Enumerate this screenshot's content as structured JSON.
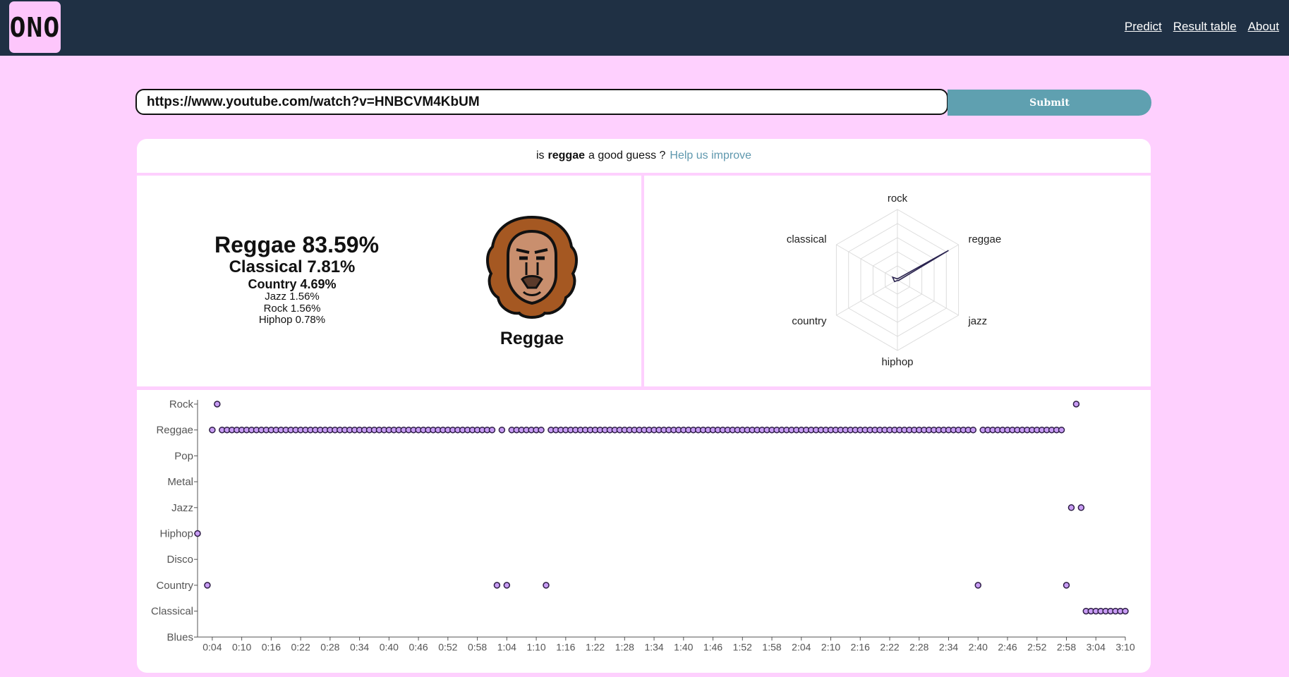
{
  "app": {
    "logo_text": "ONO"
  },
  "nav": {
    "predict": "Predict",
    "result_table": "Result table",
    "about": "About"
  },
  "search": {
    "value": "https://www.youtube.com/watch?v=HNBCVM4KbUM",
    "submit_label": "Submit"
  },
  "feedback": {
    "prefix": "is",
    "genre": "reggae",
    "suffix": "a good guess ?",
    "link": "Help us improve"
  },
  "probabilities": [
    "Reggae 83.59%",
    "Classical 7.81%",
    "Country 4.69%",
    "Jazz 1.56%",
    "Rock 1.56%",
    "Hiphop 0.78%"
  ],
  "prediction": {
    "label": "Reggae",
    "icon": "lion-icon"
  },
  "radar": {
    "axes": [
      "rock",
      "reggae",
      "jazz",
      "hiphop",
      "country",
      "classical"
    ],
    "values": [
      0.0156,
      0.8359,
      0.0156,
      0.0078,
      0.0469,
      0.0781
    ]
  },
  "chart_data": {
    "type": "scatter",
    "categories_y": [
      "Rock",
      "Reggae",
      "Pop",
      "Metal",
      "Jazz",
      "Hiphop",
      "Disco",
      "Country",
      "Classical",
      "Blues"
    ],
    "x_ticks": [
      "0:04",
      "0:10",
      "0:16",
      "0:22",
      "0:28",
      "0:34",
      "0:40",
      "0:46",
      "0:52",
      "0:58",
      "1:04",
      "1:10",
      "1:16",
      "1:22",
      "1:28",
      "1:34",
      "1:40",
      "1:46",
      "1:52",
      "1:58",
      "2:04",
      "2:10",
      "2:16",
      "2:22",
      "2:28",
      "2:34",
      "2:40",
      "2:46",
      "2:52",
      "2:58",
      "3:04",
      "3:10"
    ],
    "x_unit": "seconds",
    "xlim": [
      1,
      190
    ],
    "runs": [
      {
        "genre": "Hiphop",
        "start": 1,
        "end": 1
      },
      {
        "genre": "Country",
        "start": 3,
        "end": 3
      },
      {
        "genre": "Reggae",
        "start": 4,
        "end": 4
      },
      {
        "genre": "Rock",
        "start": 5,
        "end": 5
      },
      {
        "genre": "Reggae",
        "start": 6,
        "end": 61
      },
      {
        "genre": "Country",
        "start": 62,
        "end": 62
      },
      {
        "genre": "Reggae",
        "start": 63,
        "end": 63
      },
      {
        "genre": "Country",
        "start": 64,
        "end": 64
      },
      {
        "genre": "Reggae",
        "start": 65,
        "end": 71
      },
      {
        "genre": "Country",
        "start": 72,
        "end": 72
      },
      {
        "genre": "Reggae",
        "start": 73,
        "end": 159
      },
      {
        "genre": "Country",
        "start": 160,
        "end": 160
      },
      {
        "genre": "Reggae",
        "start": 161,
        "end": 177
      },
      {
        "genre": "Country",
        "start": 178,
        "end": 178
      },
      {
        "genre": "Jazz",
        "start": 179,
        "end": 179
      },
      {
        "genre": "Rock",
        "start": 180,
        "end": 180
      },
      {
        "genre": "Jazz",
        "start": 181,
        "end": 181
      },
      {
        "genre": "Classical",
        "start": 182,
        "end": 190
      }
    ],
    "point_colors": {
      "fill": "#c89cf4",
      "stroke": "#2c1c44"
    }
  }
}
